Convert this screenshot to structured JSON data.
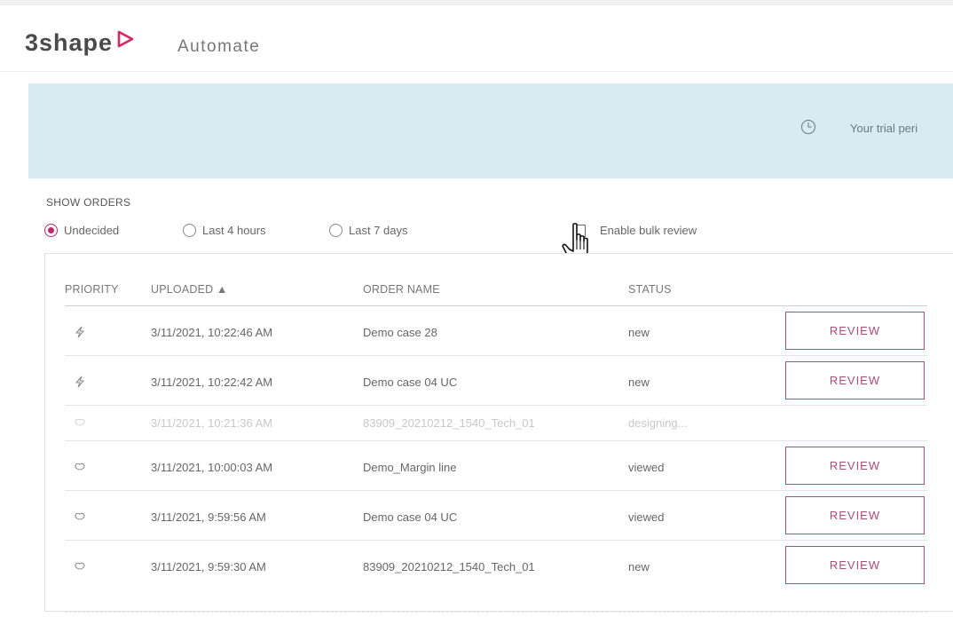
{
  "header": {
    "logo_text": "3shape",
    "app_name": "Automate"
  },
  "banner": {
    "trial_text": "Your trial peri"
  },
  "filters": {
    "heading": "SHOW ORDERS",
    "options": [
      {
        "label": "Undecided",
        "selected": true
      },
      {
        "label": "Last 4 hours",
        "selected": false
      },
      {
        "label": "Last 7 days",
        "selected": false
      }
    ],
    "bulk_review_label": "Enable bulk review",
    "bulk_review_checked": false
  },
  "table": {
    "columns": [
      "PRIORITY",
      "UPLOADED ▲",
      "ORDER NAME",
      "STATUS"
    ],
    "review_label": "REVIEW",
    "rows": [
      {
        "priority_icon": "lightning-icon",
        "uploaded": "3/11/2021, 10:22:46 AM",
        "order_name": "Demo case 28",
        "status": "new",
        "reviewable": true
      },
      {
        "priority_icon": "lightning-icon",
        "uploaded": "3/11/2021, 10:22:42 AM",
        "order_name": "Demo case 04 UC",
        "status": "new",
        "reviewable": true
      },
      {
        "priority_icon": "tooth-icon",
        "uploaded": "3/11/2021, 10:21:36 AM",
        "order_name": "83909_20210212_1540_Tech_01",
        "status": "designing...",
        "reviewable": false
      },
      {
        "priority_icon": "tooth-icon",
        "uploaded": "3/11/2021, 10:00:03 AM",
        "order_name": "Demo_Margin line",
        "status": "viewed",
        "reviewable": true
      },
      {
        "priority_icon": "tooth-icon",
        "uploaded": "3/11/2021, 9:59:56 AM",
        "order_name": "Demo case 04 UC",
        "status": "viewed",
        "reviewable": true
      },
      {
        "priority_icon": "tooth-icon",
        "uploaded": "3/11/2021, 9:59:30 AM",
        "order_name": "83909_20210212_1540_Tech_01",
        "status": "new",
        "reviewable": true
      }
    ]
  },
  "colors": {
    "accent": "#c0266b",
    "banner": "#d9ebf2",
    "review_border": "#b74a80"
  }
}
